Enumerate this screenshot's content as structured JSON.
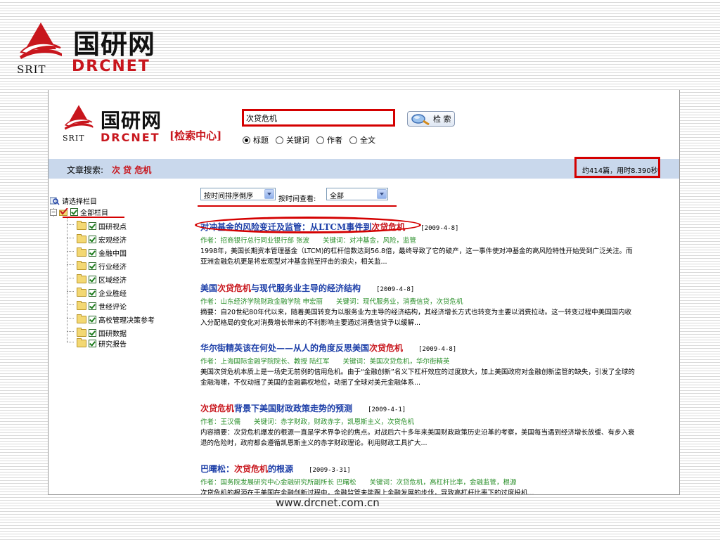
{
  "slide_logo": {
    "cn": "国研网",
    "en": "DRCNET",
    "srit": "SRIT"
  },
  "site_header": {
    "logo_cn": "国研网",
    "logo_en": "DRCNET",
    "logo_srit": "SRIT",
    "center_label": "[检索中心]",
    "search_value": "次贷危机",
    "search_button": "检 索",
    "options": [
      {
        "label": "标题",
        "checked": true
      },
      {
        "label": "关键词",
        "checked": false
      },
      {
        "label": "作者",
        "checked": false
      },
      {
        "label": "全文",
        "checked": false
      }
    ]
  },
  "results_bar": {
    "prefix": "文章搜索:",
    "query": "次 贷 危机",
    "count": "约414篇，用时8.390秒"
  },
  "tree": {
    "header": "请选择栏目",
    "root": "全部栏目",
    "items": [
      "国研视点",
      "宏观经济",
      "金融中国",
      "行业经济",
      "区域经济",
      "企业胜经",
      "世经评论",
      "高校管理决策参考",
      "国研数据",
      "研究报告"
    ]
  },
  "sort": {
    "order": "按时间排序倒序",
    "label": "按时间查看:",
    "range": "全部"
  },
  "results": [
    {
      "title_pre": "对冲基金的风险变迁及监管：从LTCM事件到",
      "title_hl": "次贷危机",
      "title_post": "",
      "date": "[2009-4-8]",
      "meta": "作者：招商银行总行同业银行部 张波　　关键词：对冲基金，风险，监管",
      "abstract": "1998年，美国长期资本管理基金（LTCM)的杠杆倍数达到56.8倍，最终导致了它的破产，这一事件使对冲基金的高风险特性开始受到广泛关注。而亚洲金融危机更是将宏观型对冲基金抛至抨击的浪尖，相关监..."
    },
    {
      "title_pre": "美国",
      "title_hl": "次贷危机",
      "title_post": "与现代服务业主导的经济结构",
      "date": "[2009-4-8]",
      "meta": "作者：山东经济学院财政金融学院 申宏丽　　关键词：现代服务业，消费信贷，次贷危机",
      "abstract": "摘要：自20世纪80年代以来，随着美国转变为以服务业为主导的经济结构，其经济增长方式也转变为主要以消费拉动。这一转变过程中美国国内收入分配格局的变化对消费增长带来的不利影响主要通过消费信贷予以缓解..."
    },
    {
      "title_pre": "华尔街精英该在何处——从人的角度反思美国",
      "title_hl": "次贷危机",
      "title_post": "",
      "date": "[2009-4-8]",
      "meta": "作者：上海国际金融学院院长、教授 陆红军　　关键词：美国次贷危机，华尔街精英",
      "abstract": "美国次贷危机本质上是一场史无前例的信用危机。由于“金融创新”名义下杠杆效应的过度放大，加上美国政府对金融创新监管的缺失，引发了全球的金融海啸，不仅动摇了美国的金融霸权地位，动摇了全球对美元金融体系..."
    },
    {
      "title_pre": "",
      "title_hl": "次贷危机",
      "title_post": "背景下美国财政政策走势的预测",
      "date": "[2009-4-1]",
      "meta": "作者：王汉儒　　关键词：赤字财政，财政赤字，凯恩斯主义，次贷危机",
      "abstract": "内容摘要：次贷危机爆发的根源一直是学术界争论的焦点。对战后六十多年来美国财政政策历史沿革的考察，美国每当遇到经济增长放缓、有步入衰退的危险时，政府都会遵循凯恩斯主义的赤字财政理论。利用财政工具扩大..."
    },
    {
      "title_pre": "巴曙松：",
      "title_hl": "次贷危机",
      "title_post": "的根源",
      "date": "[2009-3-31]",
      "meta": "作者：国务院发展研究中心金融研究所副所长 巴曙松　　关键词：次贷危机，高杠杆比率，金融监管，根源",
      "abstract": "次贷危机的根源在于美国在金融创新过程中，金融监管未能跟上金融发展的步伐，导致高杠杆比率下的过度投机..."
    }
  ],
  "footer": {
    "url": "www.drcnet.com.cn"
  },
  "colors": {
    "brand_red": "#c8161d",
    "title_blue": "#1d3fa8",
    "meta_green": "#2a8f2a",
    "bar_blue": "#c9d8ec",
    "annotation_red": "#d40000"
  }
}
